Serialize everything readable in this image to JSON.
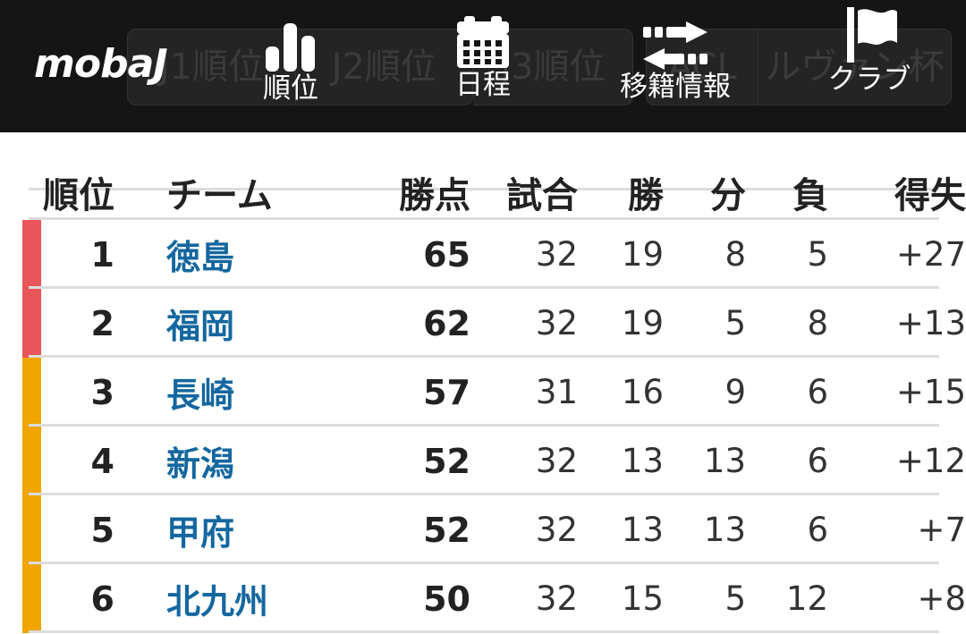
{
  "header": {
    "logo": "mobaJ",
    "background_nav": [
      {
        "label": "J1順位"
      },
      {
        "label": "J2順位"
      },
      {
        "label": "J3順位"
      },
      {
        "label": "ACL"
      },
      {
        "label": "ルヴァン杯"
      }
    ],
    "foreground_nav": [
      {
        "icon": "bar-chart-icon",
        "label": "順位"
      },
      {
        "icon": "calendar-icon",
        "label": "日程"
      },
      {
        "icon": "transfer-arrows-icon",
        "label": "移籍情報"
      },
      {
        "icon": "flag-icon",
        "label": "クラブ"
      }
    ],
    "bar_color": "#151515",
    "pill_color": "#242424",
    "pill_text_color": "#3b3b3b"
  },
  "table": {
    "columns": {
      "rank": "順位",
      "team": "チーム",
      "points": "勝点",
      "played": "試合",
      "win": "勝",
      "draw": "分",
      "loss": "負",
      "goal_diff": "得失"
    },
    "accent_colors": {
      "promotion": "#e8555a",
      "playoff": "#f0a500"
    },
    "rows": [
      {
        "rank": "1",
        "team": "徳島",
        "points": "65",
        "played": "32",
        "win": "19",
        "draw": "8",
        "loss": "5",
        "goal_diff": "+27",
        "accent": "#e8555a"
      },
      {
        "rank": "2",
        "team": "福岡",
        "points": "62",
        "played": "32",
        "win": "19",
        "draw": "5",
        "loss": "8",
        "goal_diff": "+13",
        "accent": "#e8555a"
      },
      {
        "rank": "3",
        "team": "長崎",
        "points": "57",
        "played": "31",
        "win": "16",
        "draw": "9",
        "loss": "6",
        "goal_diff": "+15",
        "accent": "#f0a500"
      },
      {
        "rank": "4",
        "team": "新潟",
        "points": "52",
        "played": "32",
        "win": "13",
        "draw": "13",
        "loss": "6",
        "goal_diff": "+12",
        "accent": "#f0a500"
      },
      {
        "rank": "5",
        "team": "甲府",
        "points": "52",
        "played": "32",
        "win": "13",
        "draw": "13",
        "loss": "6",
        "goal_diff": "+7",
        "accent": "#f0a500"
      },
      {
        "rank": "6",
        "team": "北九州",
        "points": "50",
        "played": "32",
        "win": "15",
        "draw": "5",
        "loss": "12",
        "goal_diff": "+8",
        "accent": "#f0a500"
      }
    ]
  }
}
